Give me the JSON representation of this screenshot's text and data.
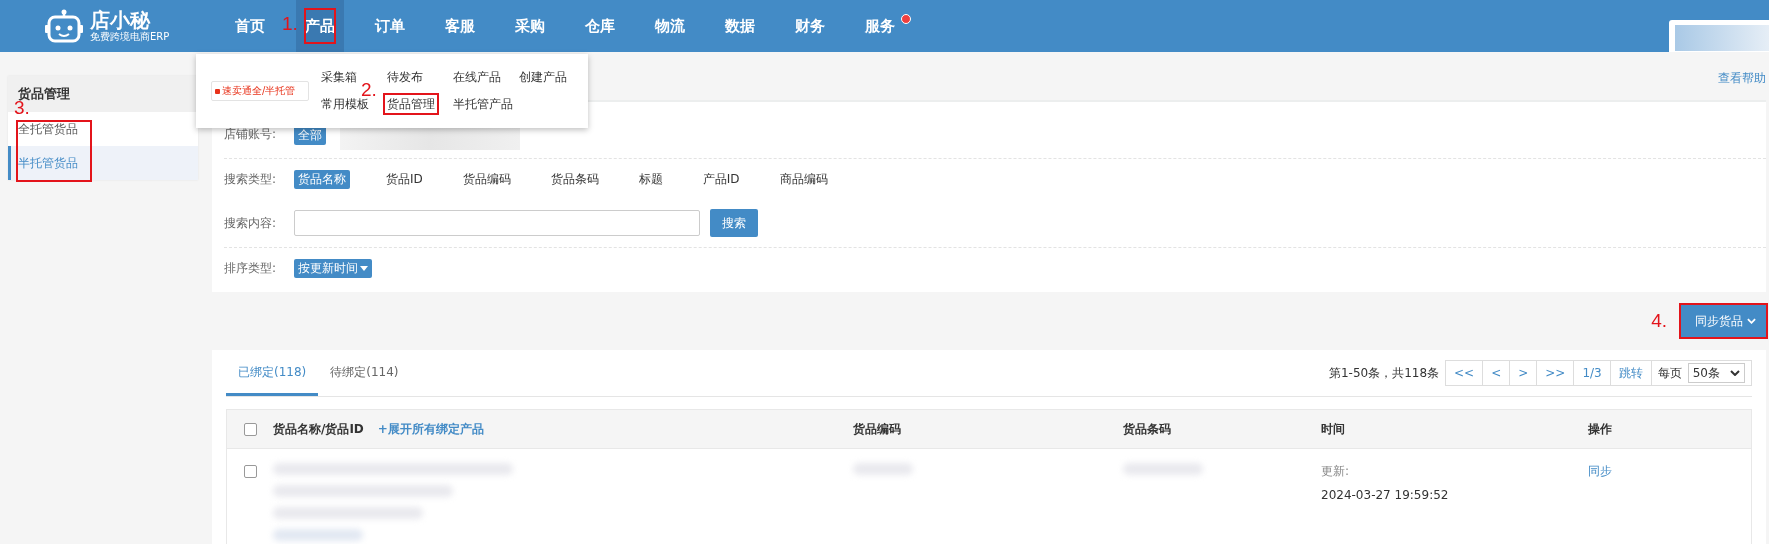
{
  "brand": {
    "name": "店小秘",
    "tagline": "免费跨境电商ERP"
  },
  "nav": [
    {
      "label": "首页",
      "selected": false,
      "highlighted": false,
      "badge": false
    },
    {
      "label": "产品",
      "selected": true,
      "highlighted": true,
      "badge": false,
      "step": "1."
    },
    {
      "label": "订单",
      "selected": false,
      "highlighted": false,
      "badge": false
    },
    {
      "label": "客服",
      "selected": false,
      "highlighted": false,
      "badge": false
    },
    {
      "label": "采购",
      "selected": false,
      "highlighted": false,
      "badge": false
    },
    {
      "label": "仓库",
      "selected": false,
      "highlighted": false,
      "badge": false
    },
    {
      "label": "物流",
      "selected": false,
      "highlighted": false,
      "badge": false
    },
    {
      "label": "数据",
      "selected": false,
      "highlighted": false,
      "badge": false
    },
    {
      "label": "财务",
      "selected": false,
      "highlighted": false,
      "badge": false
    },
    {
      "label": "服务",
      "selected": false,
      "highlighted": false,
      "badge": true
    }
  ],
  "dropdown": {
    "logo_text": "速卖通全/半托管",
    "items": [
      {
        "label": "采集箱",
        "highlighted": false
      },
      {
        "label": "待发布",
        "highlighted": false
      },
      {
        "label": "在线产品",
        "highlighted": false
      },
      {
        "label": "创建产品",
        "highlighted": false
      },
      {
        "label": "常用模板",
        "highlighted": false
      },
      {
        "label": "货品管理",
        "highlighted": true,
        "step": "2."
      },
      {
        "label": "半托管产品",
        "highlighted": false
      }
    ]
  },
  "sidebar": {
    "title": "货品管理",
    "step": "3.",
    "highlighted": true,
    "items": [
      {
        "label": "全托管货品",
        "selected": false
      },
      {
        "label": "半托管货品",
        "selected": true
      }
    ]
  },
  "help_link": "查看帮助",
  "filters": {
    "store": {
      "label": "店铺账号:",
      "options": [
        {
          "label": "全部",
          "selected": true
        }
      ]
    },
    "search_type": {
      "label": "搜索类型:",
      "options": [
        {
          "label": "货品名称",
          "selected": true
        },
        {
          "label": "货品ID",
          "selected": false
        },
        {
          "label": "货品编码",
          "selected": false
        },
        {
          "label": "货品条码",
          "selected": false
        },
        {
          "label": "标题",
          "selected": false
        },
        {
          "label": "产品ID",
          "selected": false
        },
        {
          "label": "商品编码",
          "selected": false
        }
      ]
    },
    "search_content": {
      "label": "搜索内容:",
      "button": "搜索"
    },
    "sort": {
      "label": "排序类型:",
      "value": "按更新时间"
    }
  },
  "sync_button": {
    "label": "同步货品",
    "step": "4.",
    "highlighted": true
  },
  "tabs": [
    {
      "label": "已绑定(118)",
      "selected": true
    },
    {
      "label": "待绑定(114)",
      "selected": false
    }
  ],
  "pagination": {
    "summary": "第1-50条，共118条",
    "buttons": [
      "<<",
      "<",
      ">",
      ">>",
      "1/3"
    ],
    "jump": "跳转",
    "per_page_label": "每页",
    "per_page": "50条"
  },
  "table": {
    "header_checked": false,
    "columns": [
      {
        "label": "货品名称/货品ID",
        "action": "+展开所有绑定产品"
      },
      {
        "label": "货品编码"
      },
      {
        "label": "货品条码"
      },
      {
        "label": "时间"
      },
      {
        "label": "操作"
      }
    ],
    "rows": [
      {
        "checked": false,
        "time_label": "更新:",
        "time": "2024-03-27 19:59:52",
        "action": "同步"
      }
    ]
  }
}
